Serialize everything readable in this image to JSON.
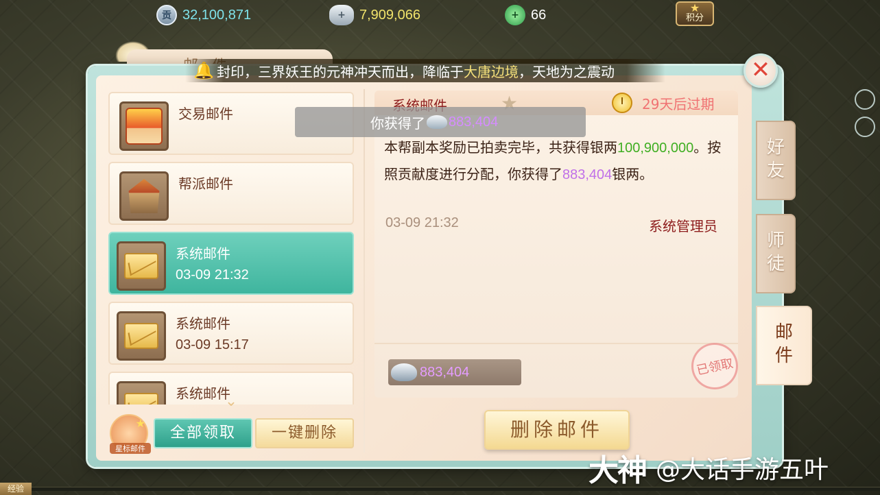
{
  "currency": {
    "gong_icon": "贡",
    "gong_value": "32,100,871",
    "silver_value": "7,909,066",
    "jade_value": "66",
    "points_label": "积分"
  },
  "window": {
    "title": "邮件"
  },
  "marquee": {
    "part1": "封印，三界妖王的元神冲天而出，降临于",
    "highlight": "大唐边境",
    "part2": "，天地为之震动"
  },
  "mail_list": [
    {
      "name": "交易邮件",
      "time": ""
    },
    {
      "name": "帮派邮件",
      "time": ""
    },
    {
      "name": "系统邮件",
      "time": "03-09 21:32",
      "selected": true
    },
    {
      "name": "系统邮件",
      "time": "03-09 15:17"
    },
    {
      "name": "系统邮件",
      "time": ""
    }
  ],
  "buttons": {
    "star_mail": "星标邮件",
    "claim_all": "全部领取",
    "delete_all": "一键删除",
    "delete_mail": "删除邮件"
  },
  "detail": {
    "title": "系统邮件",
    "expiry": "29天后过期",
    "toast_prefix": "你获得了",
    "toast_amount": "883,404",
    "body_1": "本帮副本奖励已拍卖完毕，共获得银两",
    "body_total": "100,900,000",
    "body_2": "。按照贡献度进行分配，你获得了",
    "body_amount": "883,404",
    "body_3": "银两。",
    "date": "03-09 21:32",
    "sender": "系统管理员",
    "attachment_amount": "883,404",
    "claimed_stamp": "已领取"
  },
  "side_tabs": [
    {
      "label": "好友"
    },
    {
      "label": "师徒"
    },
    {
      "label": "邮件",
      "active": true
    }
  ],
  "watermark": {
    "logo": "大神",
    "text": "@大话手游五叶"
  },
  "exp_label": "经验",
  "colors": {
    "selected_item": "#3fb59e",
    "purple_amount": "#c070e8",
    "green_amount": "#3fae22",
    "expiry_red": "#f07272",
    "sender_red": "#8e1d1d"
  }
}
